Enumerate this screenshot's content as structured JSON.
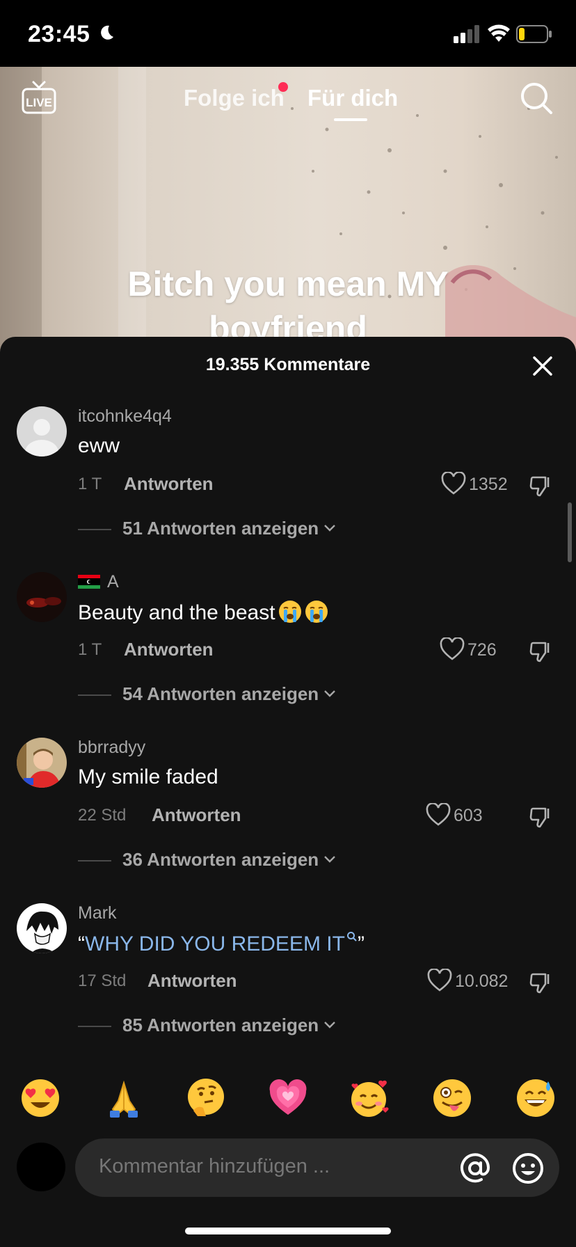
{
  "status_bar": {
    "time": "23:45"
  },
  "top_nav": {
    "tab_following": "Folge ich",
    "tab_foryou": "Für dich"
  },
  "video": {
    "caption_line1": "Bitch you mean MY",
    "caption_line2": "boyfriend"
  },
  "comments_sheet": {
    "title": "19.355 Kommentare",
    "reply_label": "Antworten",
    "comments": [
      {
        "username": "itcohnke4q4",
        "text": "eww",
        "time": "1 T",
        "likes": "1352",
        "replies": "51 Antworten anzeigen"
      },
      {
        "username": "A",
        "text": "Beauty and the beast",
        "time": "1 T",
        "likes": "726",
        "replies": "54 Antworten anzeigen"
      },
      {
        "username": "bbrradyy",
        "text": "My smile faded",
        "time": "22 Std",
        "likes": "603",
        "replies": "36 Antworten anzeigen"
      },
      {
        "username": "Mark",
        "quote_open": "“",
        "text": "WHY DID YOU REDEEM IT",
        "quote_close": "”",
        "time": "17 Std",
        "likes": "10.082",
        "replies": "85 Antworten anzeigen"
      }
    ]
  },
  "emoji_bar": [
    "heart-eyes",
    "folded-hands",
    "thinking-face",
    "growing-heart",
    "smiling-face-with-hearts",
    "winking-face-with-tongue",
    "grinning-face-with-sweat"
  ],
  "input": {
    "placeholder": "Kommentar hinzufügen ..."
  },
  "colors": {
    "accent_red": "#fe2c55",
    "link_blue": "#8ab7ea",
    "sheet_bg": "#121212"
  }
}
